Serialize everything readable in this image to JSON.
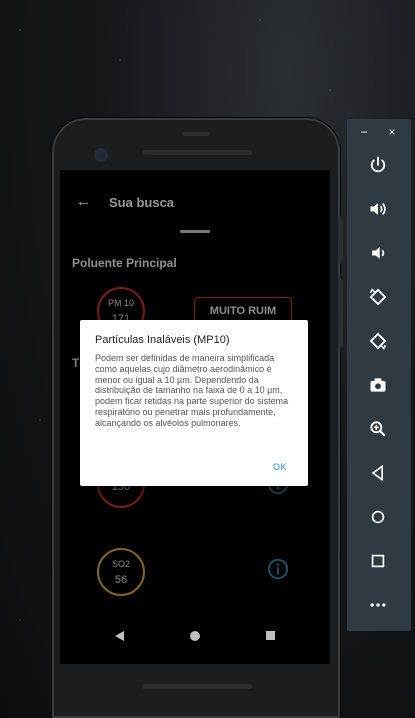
{
  "app": {
    "title": "Sua busca",
    "section_title": "Poluente Principal",
    "main_pollutant": {
      "name": "PM 10",
      "value": "171",
      "status": "MUITO RUIM"
    },
    "partial_heading_letter": "T",
    "pollutant_rows": [
      {
        "name": "",
        "value": "130"
      },
      {
        "name": "SO2",
        "value": "56"
      }
    ]
  },
  "dialog": {
    "title": "Partículas Inaláveis (MP10)",
    "body": "Podem ser definidas de maneira simplificada como aquelas cujo diâmetro aerodinâmico é menor ou igual a 10 µm. Dependendo da distribuição de tamanho na faixa de 0 a 10 µm, podem ficar retidas na parte superior do sistema respiratório ou penetrar mais profundamente, alcançando os alvéolos pulmonares.",
    "ok_label": "OK"
  },
  "toolbar": {
    "minimize": "−",
    "close": "×",
    "buttons": [
      "power-icon",
      "volume-up-icon",
      "volume-down-icon",
      "rotate-left-icon",
      "rotate-right-icon",
      "camera-icon",
      "zoom-icon",
      "back-icon",
      "home-icon",
      "overview-icon",
      "more-icon"
    ]
  },
  "colors": {
    "danger": "#c42b2b",
    "moderate": "#c9a227",
    "info": "#1e88a8",
    "accent": "#1e88e5"
  }
}
